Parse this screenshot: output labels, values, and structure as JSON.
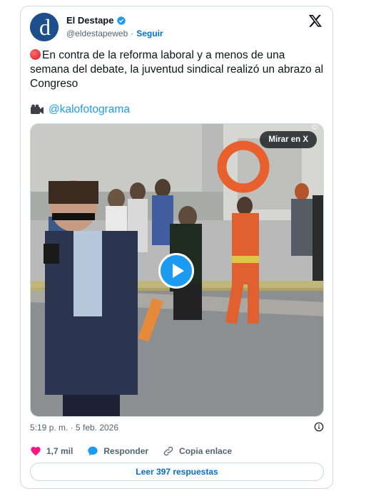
{
  "author": {
    "name": "El Destape",
    "handle": "@eldestapeweb",
    "separator": "·",
    "follow_label": "Seguir",
    "avatar_letter": "d"
  },
  "tweet": {
    "text": "En contra de la reforma laboral y a menos de una semana del debate, la juventud sindical realizó un abrazo al Congreso",
    "credit": "@kalofotograma"
  },
  "media": {
    "watch_label": "Mirar en X",
    "corner_mark": "©"
  },
  "meta": {
    "timestamp": "5:19 p. m. · 5 feb. 2026"
  },
  "actions": {
    "likes": "1,7 mil",
    "reply_label": "Responder",
    "copy_label": "Copia enlace"
  },
  "replies_button": "Leer 397 respuestas",
  "colors": {
    "accent": "#1d9bf0",
    "link": "#006fd6",
    "like": "#f91880",
    "secondary_text": "#536471"
  },
  "icons": [
    "verified-badge-icon",
    "x-logo-icon",
    "red-circle-icon",
    "video-camera-icon",
    "play-icon",
    "info-icon",
    "heart-icon",
    "speech-bubble-icon",
    "link-icon"
  ]
}
